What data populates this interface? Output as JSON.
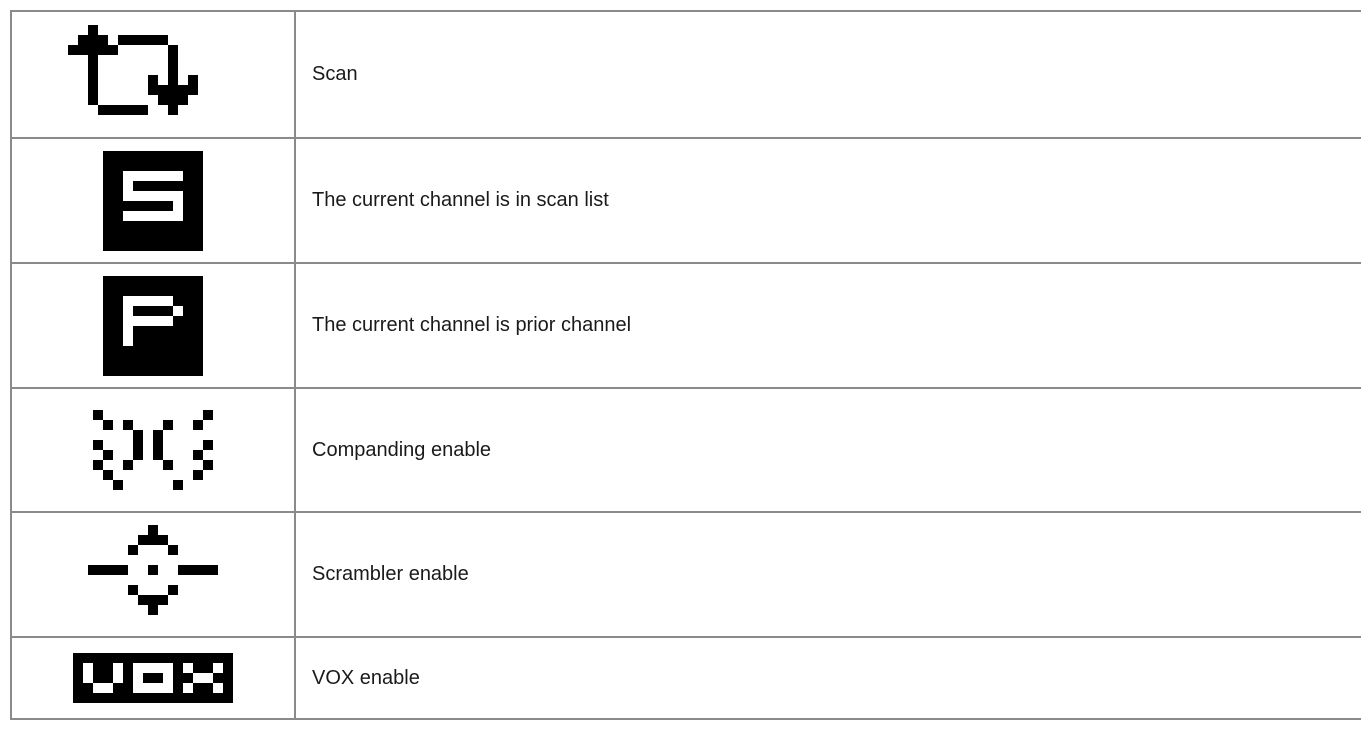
{
  "rows": [
    {
      "icon": "scan-arrows-icon",
      "label": "Scan"
    },
    {
      "icon": "scan-list-s-icon",
      "label": "The current channel is in scan list"
    },
    {
      "icon": "priority-p-icon",
      "label": "The current channel is prior channel"
    },
    {
      "icon": "compandor-icon",
      "label": "Companding enable"
    },
    {
      "icon": "scrambler-icon",
      "label": "Scrambler enable"
    },
    {
      "icon": "vox-icon",
      "label": "VOX enable"
    }
  ],
  "colors": {
    "border": "#8a8a8a",
    "text": "#1a1a1a",
    "icon": "#000000"
  }
}
